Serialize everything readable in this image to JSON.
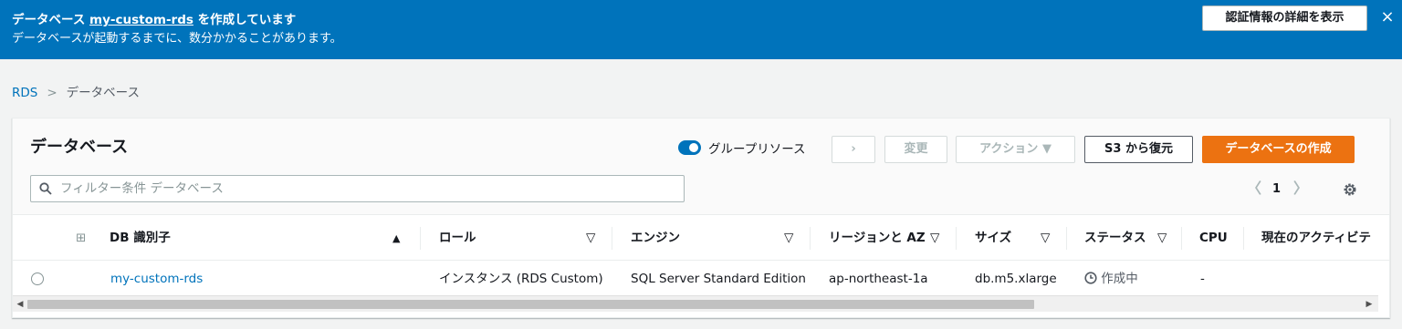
{
  "banner": {
    "title_prefix": "データベース ",
    "db_name": "my-custom-rds",
    "title_suffix": " を作成しています",
    "description": "データベースが起動するまでに、数分かかることがあります。",
    "credentials_button": "認証情報の詳細を表示",
    "close_icon": "×"
  },
  "breadcrumb": {
    "root": "RDS",
    "separator": ">",
    "current": "データベース"
  },
  "panel": {
    "title": "データベース",
    "group_toggle_label": "グループリソース",
    "group_toggle_on": true,
    "small_button": "›",
    "modify_button": "変更",
    "actions_button": "アクション ▼",
    "restore_s3_button": "S3 から復元",
    "create_button": "データベースの作成",
    "filter_placeholder": "フィルター条件 データベース",
    "pagination": {
      "prev": "〈",
      "page": "1",
      "next": "〉"
    },
    "accent_color": "#0073bb",
    "primary_color": "#ec7211"
  },
  "table": {
    "expand_icon": "⊞",
    "headers": {
      "id": "DB 識別子",
      "role": "ロール",
      "engine": "エンジン",
      "region": "リージョンと AZ",
      "size": "サイズ",
      "status": "ステータス",
      "cpu": "CPU",
      "activity": "現在のアクティビテ"
    },
    "sort_asc_icon": "▲",
    "filter_arrow_icon": "▽",
    "rows": [
      {
        "id": "my-custom-rds",
        "role": "インスタンス (RDS Custom)",
        "engine": "SQL Server Standard Edition",
        "region": "ap-northeast-1a",
        "size": "db.m5.xlarge",
        "status_icon": "clock-icon",
        "status": "作成中",
        "cpu": "-"
      }
    ]
  }
}
